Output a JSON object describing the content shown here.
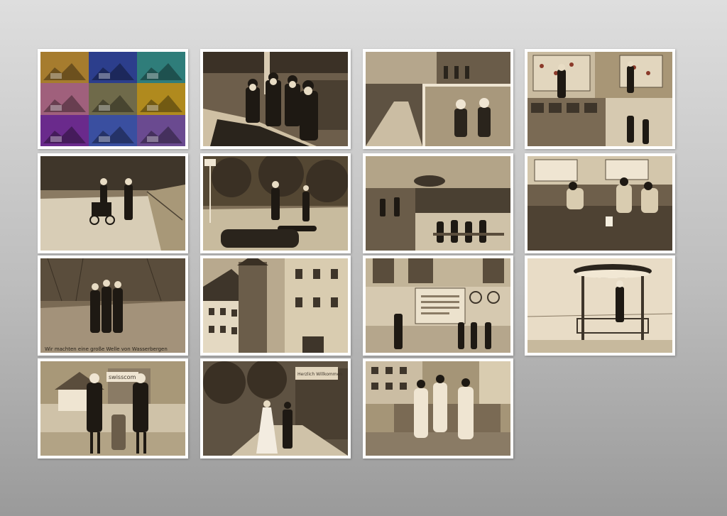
{
  "gallery": {
    "photos": [
      {
        "id": "popart",
        "subject": "pop-art multicolor grid of vintage car in park"
      },
      {
        "id": "train-hall",
        "subject": "men in top hats beside model railway in a hall"
      },
      {
        "id": "collage-street",
        "subject": "collage of street scenes with masked figures"
      },
      {
        "id": "collage-board",
        "subject": "collage of people at display boards and smoky street"
      },
      {
        "id": "road-walk",
        "subject": "couple walking with cart on a country road"
      },
      {
        "id": "forest-road",
        "subject": "figures acting on road near forest with motorcycle"
      },
      {
        "id": "collage-square",
        "subject": "collage of town square gathering and spectators"
      },
      {
        "id": "garden-work",
        "subject": "people working in a garden bed"
      },
      {
        "id": "forest-group",
        "subject": "group huddled on forest slope"
      },
      {
        "id": "tower-town",
        "subject": "old town houses and stone tower"
      },
      {
        "id": "plaque-wall",
        "subject": "building facade with plaque, cyclist and performers"
      },
      {
        "id": "kiosk",
        "subject": "woman standing on round ornamental kiosk"
      },
      {
        "id": "clowns-street",
        "subject": "two costumed performers on a street"
      },
      {
        "id": "wedding-forest",
        "subject": "bride and groom walking on forest path"
      },
      {
        "id": "fountain",
        "subject": "white-clad figures at a stone fountain"
      }
    ],
    "captions": {
      "forest_group": "Wir machten eine große Welle von Wasserbergen",
      "clowns_sign": "swisscom",
      "wedding_sign": "Herzlich Willkommen"
    }
  }
}
